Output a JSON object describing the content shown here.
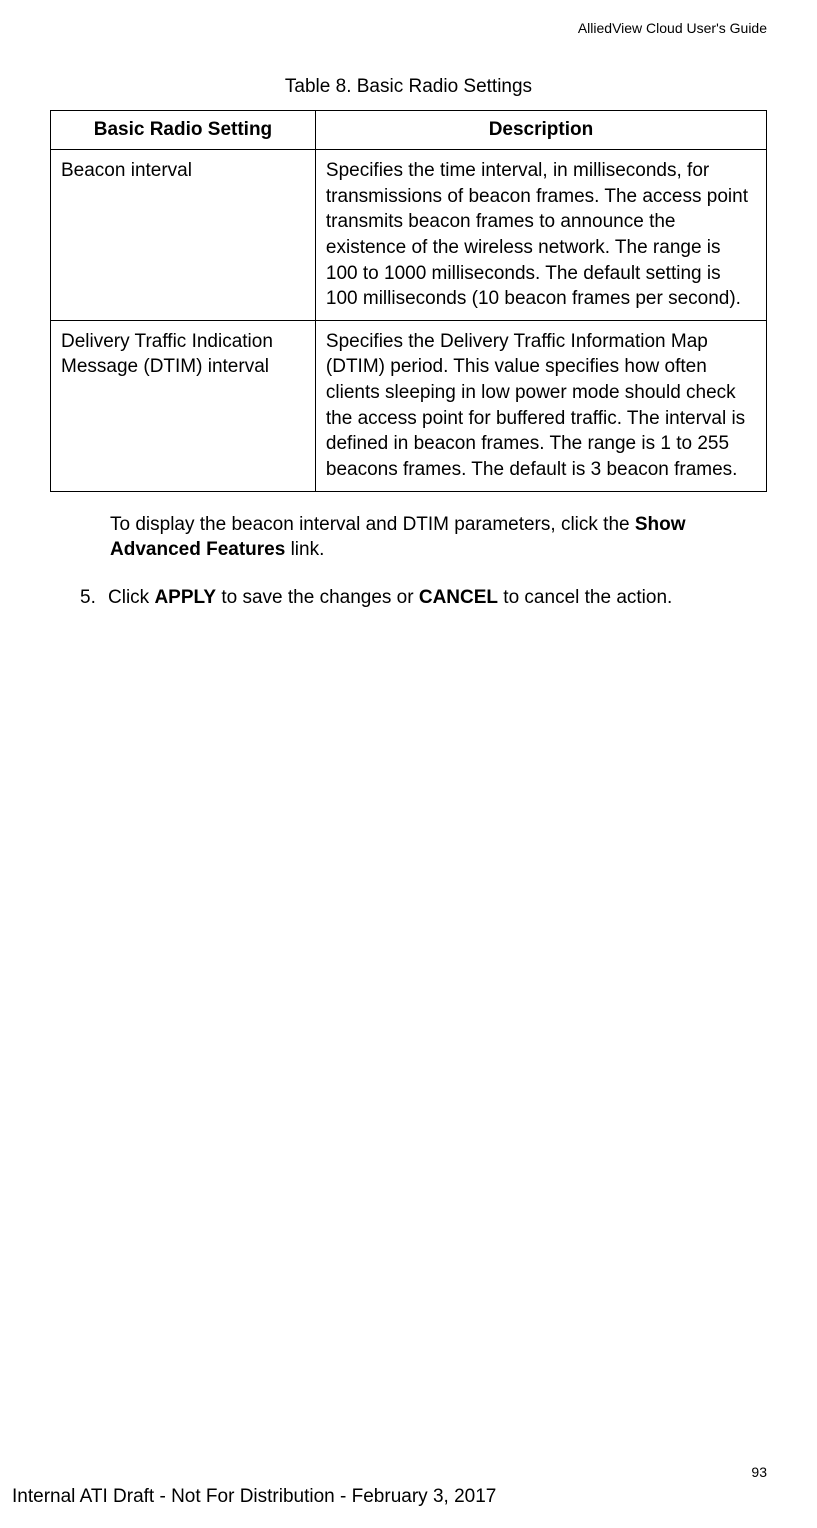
{
  "header": {
    "guide_title": "AlliedView Cloud User's Guide"
  },
  "table": {
    "caption": "Table 8. Basic Radio Settings",
    "headers": {
      "col1": "Basic Radio Setting",
      "col2": "Description"
    },
    "rows": [
      {
        "setting": "Beacon interval",
        "description": "Specifies the time interval, in milliseconds, for transmissions of beacon frames. The access point transmits beacon frames to announce the existence of the wireless network. The range is 100 to 1000 milliseconds. The default setting is 100 milliseconds (10 beacon frames per second)."
      },
      {
        "setting": "Delivery Traffic Indication Message (DTIM) interval",
        "description": "Specifies the Delivery Traffic Information Map (DTIM) period. This value specifies how often clients sleeping in low power mode should check the access point for buffered traffic. The interval is defined in beacon frames. The range is 1 to 255 beacons frames. The default is 3 beacon frames."
      }
    ]
  },
  "body": {
    "para1_part1": "To display the beacon interval and DTIM parameters, click the ",
    "para1_bold": "Show Advanced Features",
    "para1_part2": " link.",
    "step_num": "5.",
    "step_part1": "Click ",
    "step_bold1": "APPLY",
    "step_part2": " to save the changes or ",
    "step_bold2": "CANCEL",
    "step_part3": " to cancel the action."
  },
  "page_number": "93",
  "footer": "Internal ATI Draft - Not For Distribution - February 3, 2017"
}
